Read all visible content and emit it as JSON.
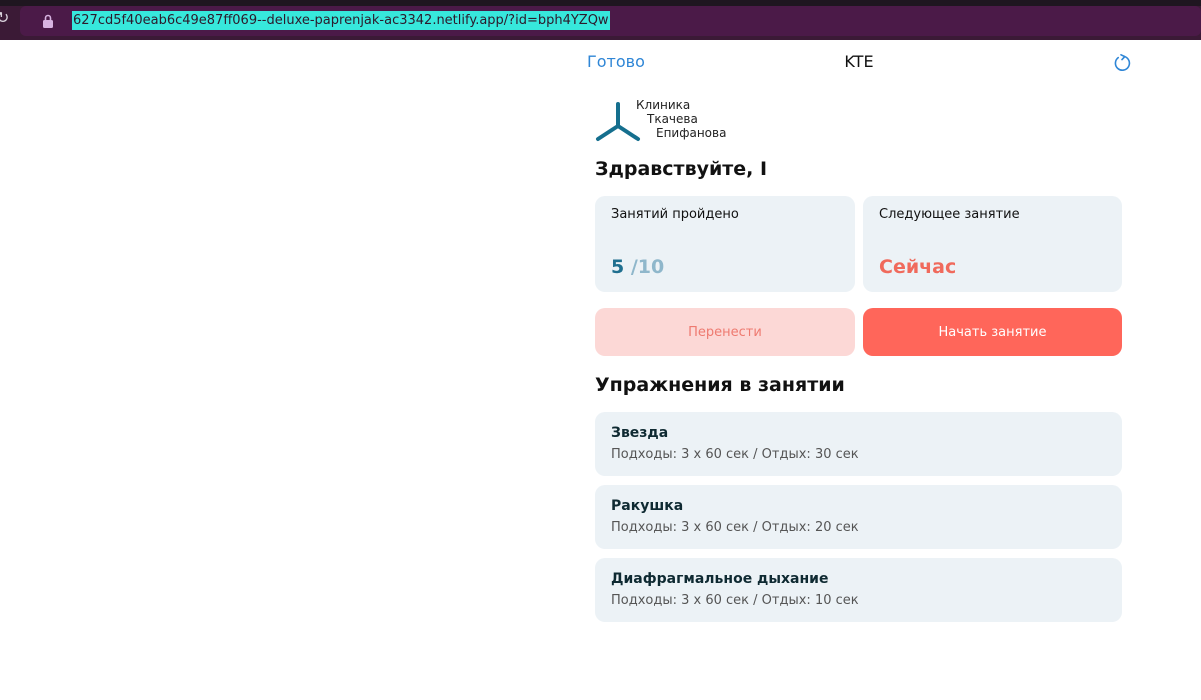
{
  "browser": {
    "url": "627cd5f40eab6c49e87ff069--deluxe-paprenjak-ac3342.netlify.app/?id=bph4YZQw",
    "reload_icon": "reload-icon",
    "lock_icon": "lock-icon"
  },
  "nav": {
    "done_label": "Готово",
    "title": "KTE",
    "refresh_icon": "refresh-icon"
  },
  "logo": {
    "line1": "Клиника",
    "line2": "Ткачева",
    "line3": "Епифанова",
    "icon": "tripod-logo-icon",
    "color": "#156f8e"
  },
  "greeting": "Здравствуйте, I",
  "stats": {
    "completed_label": "Занятий пройдено",
    "completed_count": "5",
    "total_count": "/10",
    "next_label": "Следующее занятие",
    "next_value": "Сейчас"
  },
  "actions": {
    "reschedule_label": "Перенести",
    "start_label": "Начать занятие"
  },
  "exercises_title": "Упражнения в занятии",
  "exercises": [
    {
      "name": "Звезда",
      "details": "Подходы: 3 x 60 сек / Отдых: 30 сек"
    },
    {
      "name": "Ракушка",
      "details": "Подходы: 3 x 60 сек / Отдых: 20 сек"
    },
    {
      "name": "Диафрагмальное дыхание",
      "details": "Подходы: 3 x 60 сек / Отдых: 10 сек"
    }
  ],
  "colors": {
    "accent_blue": "#2f86d6",
    "accent_coral": "#ff665a",
    "card_bg": "#ecf2f6",
    "reschedule_bg": "#fcd8d6"
  }
}
